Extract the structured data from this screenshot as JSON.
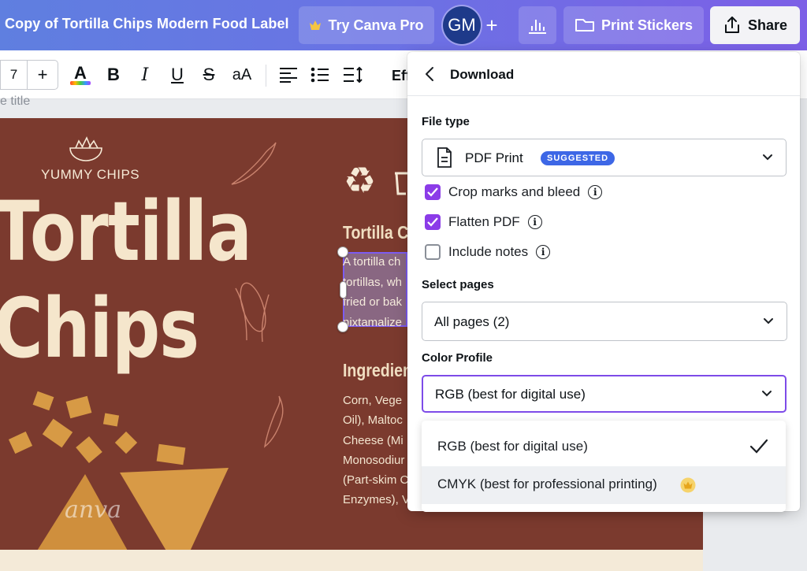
{
  "header": {
    "doc_title": "Copy of Tortilla Chips Modern Food Label",
    "try_pro": "Try Canva Pro",
    "avatar_initials": "GM",
    "add": "+",
    "print": "Print Stickers",
    "share": "Share"
  },
  "toolbar": {
    "font_size": "7",
    "increase": "+",
    "bold": "B",
    "italic": "I",
    "underline": "U",
    "strike": "S",
    "case": "aA",
    "effects": "Eff"
  },
  "canvas": {
    "title_hint": "e title",
    "brand": "YUMMY CHIPS",
    "title_line1": "Tortilla",
    "title_line2": "Chips",
    "heading1": "Tortilla C",
    "body_lines": [
      "A tortilla ch",
      "tortillas, wh",
      "fried or bak",
      "nixtamalize"
    ],
    "heading2": "Ingredien",
    "ingredient_lines": [
      "Corn, Vege",
      "Oil), Maltoc",
      "Cheese (Mi",
      "Monosodiur",
      "(Part-skim C",
      "Enzymes), V"
    ],
    "watermark": "anva"
  },
  "download": {
    "title": "Download",
    "file_type_label": "File type",
    "file_type_value": "PDF Print",
    "suggested_badge": "SUGGESTED",
    "options": [
      {
        "label": "Crop marks and bleed",
        "checked": true
      },
      {
        "label": "Flatten PDF",
        "checked": true
      },
      {
        "label": "Include notes",
        "checked": false
      }
    ],
    "select_pages_label": "Select pages",
    "select_pages_value": "All pages (2)",
    "color_profile_label": "Color Profile",
    "color_profile_value": "RGB (best for digital use)",
    "color_options": [
      {
        "label": "RGB (best for digital use)",
        "selected": true
      },
      {
        "label": "CMYK (best for professional printing)",
        "selected": false,
        "pro": true
      }
    ]
  },
  "colors": {
    "accent": "#8b3ce8",
    "badge": "#3d67e6",
    "canvas_bg": "#7b3a2e",
    "title_cream": "#f5e6cc"
  }
}
